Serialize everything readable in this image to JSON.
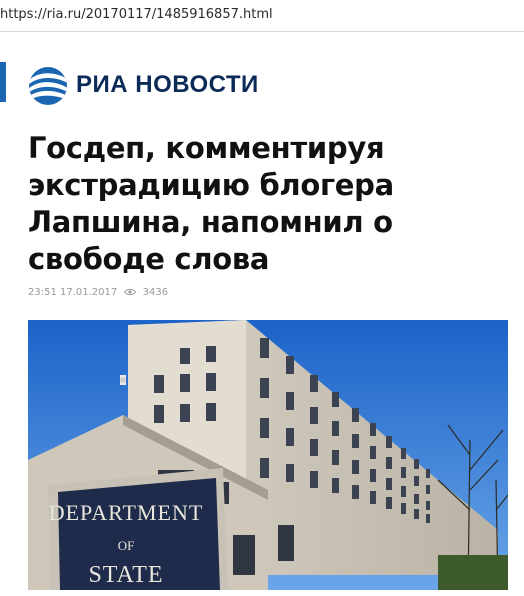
{
  "browser": {
    "url": "https://ria.ru/20170117/1485916857.html"
  },
  "brand": {
    "name": "РИА НОВОСТИ",
    "accent": "#1a66b0",
    "text_color": "#0b2a57"
  },
  "article": {
    "headline": "Госдеп, комментируя экстрадицию блогера Лапшина, напомнил о свободе слова",
    "timestamp": "23:51 17.01.2017",
    "views": "3436",
    "image": {
      "sign_line1": "DEPARTMENT",
      "sign_line2": "OF",
      "sign_line3": "STATE"
    }
  }
}
